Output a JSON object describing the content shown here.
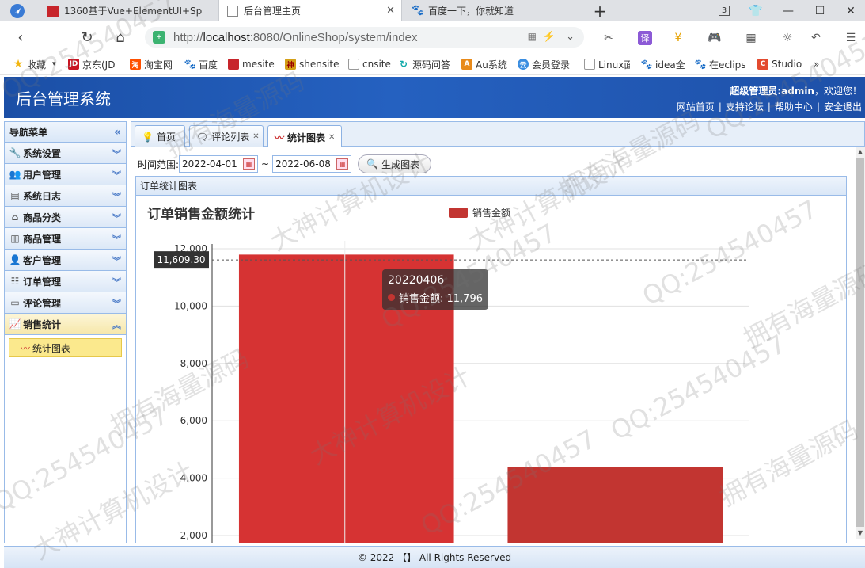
{
  "browser": {
    "tabs": [
      {
        "label": "1360基于Vue+ElementUI+Sp",
        "active": false
      },
      {
        "label": "后台管理主页",
        "active": true
      },
      {
        "label": "百度一下，你就知道",
        "active": false
      }
    ],
    "tab_count": "3",
    "url_prefix": "http://",
    "url_host": "localhost",
    "url_rest": ":8080/OnlineShop/system/index",
    "bookmarks": [
      "收藏",
      "京东(JD",
      "淘宝网",
      "百度",
      "mesite",
      "shensite",
      "cnsite",
      "源码问答",
      "Au系统",
      "会员登录",
      "Linux面",
      "idea全",
      "在eclips",
      "Studio"
    ],
    "more": "»"
  },
  "app": {
    "title": "后台管理系统",
    "welcome_prefix": "超级管理员:admin",
    "welcome_suffix": "，欢迎您！",
    "links": [
      "网站首页",
      "支持论坛",
      "帮助中心",
      "安全退出"
    ]
  },
  "sidebar": {
    "title": "导航菜单",
    "items": [
      {
        "label": "系统设置",
        "icon": "wrench-icon"
      },
      {
        "label": "用户管理",
        "icon": "user-icon"
      },
      {
        "label": "系统日志",
        "icon": "log-icon"
      },
      {
        "label": "商品分类",
        "icon": "category-icon"
      },
      {
        "label": "商品管理",
        "icon": "goods-icon"
      },
      {
        "label": "客户管理",
        "icon": "customer-icon"
      },
      {
        "label": "订单管理",
        "icon": "order-icon"
      },
      {
        "label": "评论管理",
        "icon": "comment-icon"
      },
      {
        "label": "销售统计",
        "icon": "chart-icon",
        "open": true
      }
    ],
    "sub_item": "统计图表"
  },
  "main_tabs": [
    {
      "label": "首页",
      "closable": false
    },
    {
      "label": "评论列表",
      "closable": true
    },
    {
      "label": "统计图表",
      "closable": true,
      "active": true
    }
  ],
  "toolbar": {
    "range_label": "时间范围:",
    "start_date": "2022-04-01",
    "separator": "~",
    "end_date": "2022-06-08",
    "generate_button": "生成图表"
  },
  "panel_title": "订单统计图表",
  "chart_data": {
    "type": "bar",
    "title": "订单销售金额统计",
    "categories": [
      "20220406",
      ""
    ],
    "series": [
      {
        "name": "销售金额",
        "values": [
          11796,
          4400
        ]
      }
    ],
    "ylim": [
      2000,
      12000
    ],
    "yticks": [
      "2,000",
      "4,000",
      "6,000",
      "8,000",
      "10,000",
      "12,000"
    ],
    "ytick_values": [
      2000,
      4000,
      6000,
      8000,
      10000,
      12000
    ],
    "color": "#d63333",
    "crosshair_value": 11609.3,
    "crosshair_label": "11,609.30",
    "tooltip_title": "20220406",
    "tooltip_label": "销售金额: 11,796",
    "legend": "top-center"
  },
  "footer": "© 2022 【】 All Rights Reserved",
  "watermarks": [
    "QQ:254540457",
    "拥有海量源码",
    "大神计算机设计"
  ]
}
